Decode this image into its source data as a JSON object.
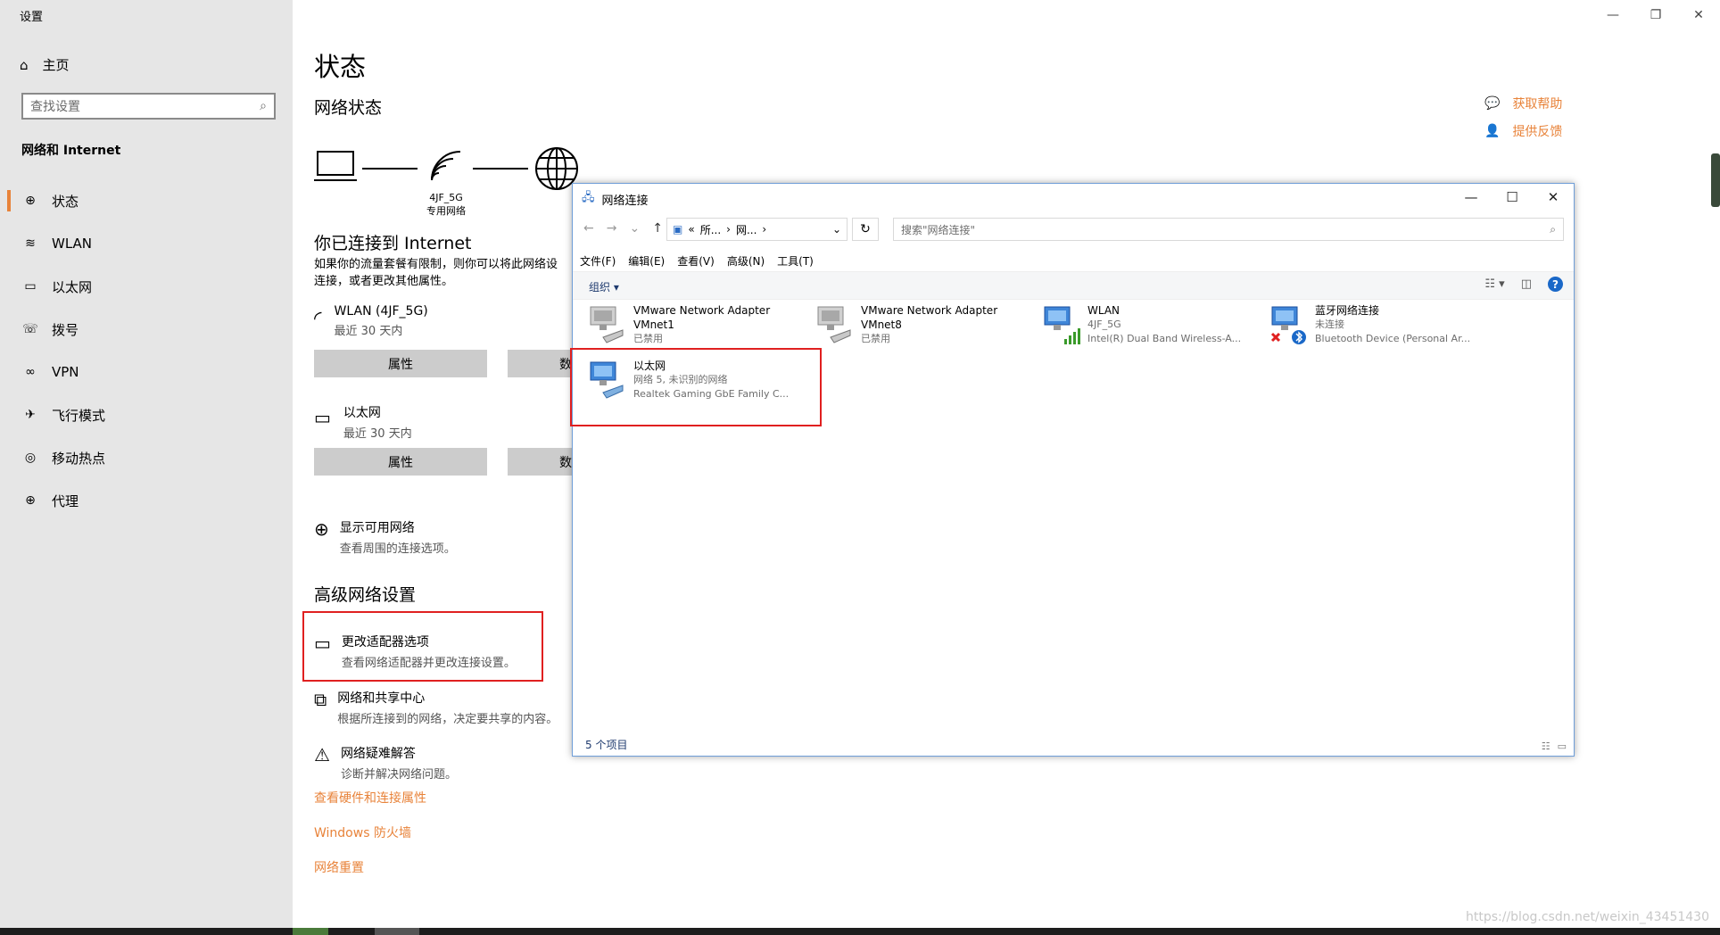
{
  "settings": {
    "app_title": "设置",
    "home_label": "主页",
    "search_placeholder": "查找设置",
    "section_label": "网络和 Internet",
    "nav": [
      {
        "label": "状态",
        "icon": "status-globe-icon"
      },
      {
        "label": "WLAN",
        "icon": "wifi-icon"
      },
      {
        "label": "以太网",
        "icon": "ethernet-icon"
      },
      {
        "label": "拨号",
        "icon": "dialup-icon"
      },
      {
        "label": "VPN",
        "icon": "vpn-icon"
      },
      {
        "label": "飞行模式",
        "icon": "airplane-icon"
      },
      {
        "label": "移动热点",
        "icon": "hotspot-icon"
      },
      {
        "label": "代理",
        "icon": "proxy-globe-icon"
      }
    ],
    "window_controls": [
      "—",
      "❐",
      "✕"
    ]
  },
  "status_page": {
    "title": "状态",
    "subtitle": "网络状态",
    "diagram_ssid": "4JF_5G",
    "diagram_profile": "专用网络",
    "connected_heading": "你已连接到 Internet",
    "connected_desc_1": "如果你的流量套餐有限制，则你可以将此网络设",
    "connected_desc_2": "连接，或者更改其他属性。",
    "wlan": {
      "name": "WLAN (4JF_5G)",
      "usage": "最近 30 天内",
      "btn_properties": "属性",
      "btn_data": "数"
    },
    "ethernet": {
      "name": "以太网",
      "usage": "最近 30 天内",
      "btn_properties": "属性",
      "btn_data": "数"
    },
    "show_networks": {
      "title": "显示可用网络",
      "desc": "查看周围的连接选项。"
    },
    "advanced_heading": "高级网络设置",
    "adapter_options": {
      "title": "更改适配器选项",
      "desc": "查看网络适配器并更改连接设置。"
    },
    "sharing_center": {
      "title": "网络和共享中心",
      "desc": "根据所连接到的网络，决定要共享的内容。"
    },
    "troubleshoot": {
      "title": "网络疑难解答",
      "desc": "诊断并解决网络问题。"
    },
    "link_hardware": "查看硬件和连接属性",
    "link_firewall": "Windows 防火墙",
    "link_reset": "网络重置",
    "help": "获取帮助",
    "feedback": "提供反馈"
  },
  "explorer": {
    "title": "网络连接",
    "address_prefix": "«",
    "address_part1": "所...",
    "address_part2": "网...",
    "search_placeholder": "搜索\"网络连接\"",
    "menu": [
      "文件(F)",
      "编辑(E)",
      "查看(V)",
      "高级(N)",
      "工具(T)"
    ],
    "organize": "组织 ▾",
    "items": [
      {
        "name": "VMware Network Adapter",
        "line2": "VMnet1",
        "line3": "已禁用"
      },
      {
        "name": "VMware Network Adapter",
        "line2": "VMnet8",
        "line3": "已禁用"
      },
      {
        "name": "WLAN",
        "line2": "4JF_5G",
        "line3": "Intel(R) Dual Band Wireless-A..."
      },
      {
        "name": "蓝牙网络连接",
        "line2": "未连接",
        "line3": "Bluetooth Device (Personal Ar..."
      },
      {
        "name": "以太网",
        "line2": "网络 5, 未识别的网络",
        "line3": "Realtek Gaming GbE Family C..."
      }
    ],
    "status_count": "5 个项目"
  },
  "watermark": "https://blog.csdn.net/weixin_43451430"
}
